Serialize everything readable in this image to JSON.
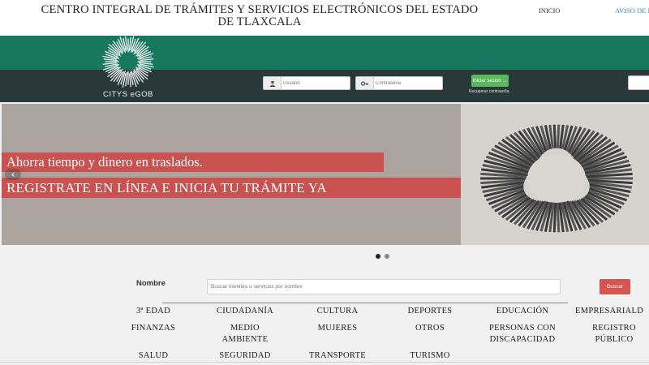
{
  "header": {
    "title": "CENTRO INTEGRAL DE TRÁMITES Y SERVICIOS ELECTRÓNICOS DEL ESTADO DE TLAXCALA",
    "nav": [
      "INICIO",
      "AVISO DE P"
    ]
  },
  "logo": {
    "text": "CITYS eGOB"
  },
  "login": {
    "user_placeholder": "Usuario",
    "pass_placeholder": "Contraseña",
    "button_label": "Iniciar sesión →",
    "recover_link": "Recuperar contraseña"
  },
  "carousel": {
    "line1": "Ahorra tiempo y dinero en traslados.",
    "line2": "REGISTRATE EN LÍNEA E INICIA TU TRÁMITE YA",
    "prev_icon": "chevron-left-icon",
    "slide_count": 2,
    "active_slide": 1
  },
  "search": {
    "label": "Nombre",
    "placeholder": "Buscar trámites o servicios por nombre",
    "button": "Buscar"
  },
  "categories": [
    [
      "3ª EDAD",
      "CIUDADANÍA",
      "CULTURA",
      "DEPORTES",
      "EDUCACIÓN",
      "EMPRESARIALD"
    ],
    [
      "FINANZAS",
      "MEDIO AMBIENTE",
      "MUJERES",
      "OTROS",
      "PERSONAS CON DISCAPACIDAD",
      "REGISTRO PÚBLICO"
    ],
    [
      "SALUD",
      "SEGURIDAD",
      "TRANSPORTE",
      "TURISMO"
    ]
  ],
  "colors": {
    "green_bar": "#16785e",
    "dark_bar": "#29393a",
    "banner_red": "#c9514f",
    "login_button": "#5cb85c",
    "search_button": "#d9534f"
  }
}
